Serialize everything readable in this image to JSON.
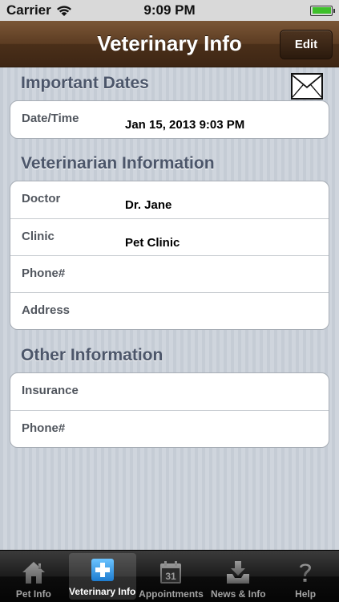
{
  "status_bar": {
    "carrier": "Carrier",
    "time": "9:09 PM"
  },
  "nav": {
    "title": "Veterinary Info",
    "edit_label": "Edit"
  },
  "sections": {
    "important_dates": {
      "header": "Important Dates",
      "rows": [
        {
          "label": "Date/Time",
          "value": "Jan 15, 2013 9:03 PM"
        }
      ]
    },
    "veterinarian": {
      "header": "Veterinarian Information",
      "rows": [
        {
          "label": "Doctor",
          "value": "Dr. Jane"
        },
        {
          "label": "Clinic",
          "value": "Pet Clinic"
        },
        {
          "label": "Phone#",
          "value": ""
        },
        {
          "label": "Address",
          "value": ""
        }
      ]
    },
    "other": {
      "header": "Other Information",
      "rows": [
        {
          "label": "Insurance",
          "value": ""
        },
        {
          "label": "Phone#",
          "value": ""
        }
      ]
    }
  },
  "tabs": [
    {
      "label": "Pet Info",
      "icon": "house-icon",
      "active": false
    },
    {
      "label": "Veterinary Info",
      "icon": "medical-cross-icon",
      "active": true
    },
    {
      "label": "Appointments",
      "icon": "calendar-icon",
      "active": false
    },
    {
      "label": "News & Info",
      "icon": "inbox-download-icon",
      "active": false
    },
    {
      "label": "Help",
      "icon": "question-mark-icon",
      "active": false
    }
  ],
  "calendar_day": "31",
  "colors": {
    "nav_brown": "#5c3c22",
    "section_header": "#4c566a",
    "tab_active_icon": "#3a9ee0",
    "battery": "#3ec02a"
  }
}
